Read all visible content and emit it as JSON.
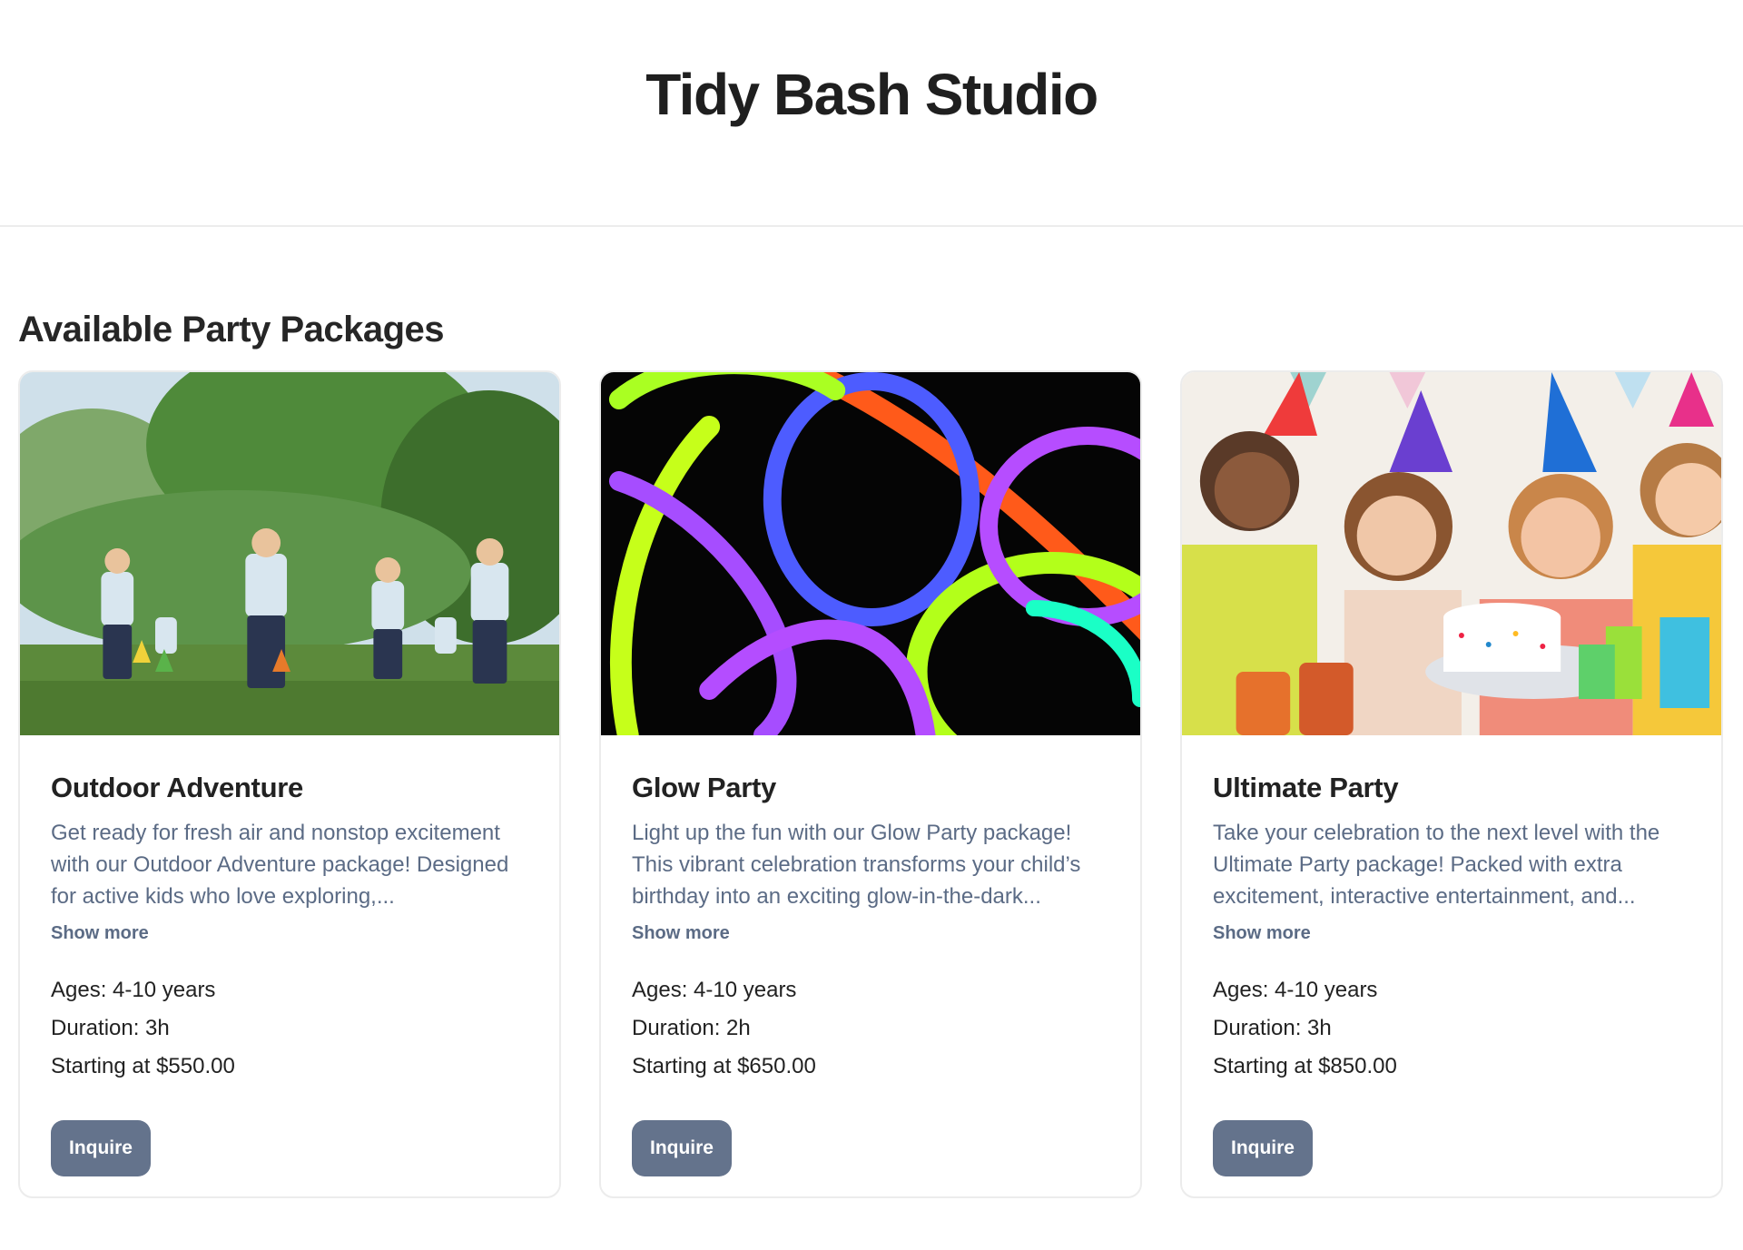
{
  "header": {
    "title": "Tidy Bash Studio"
  },
  "main": {
    "section_title": "Available Party Packages"
  },
  "colors": {
    "button_bg": "#64738c",
    "desc_text": "#5b6b85"
  },
  "packages": [
    {
      "name": "Outdoor Adventure",
      "image": "kids-playing-outdoors-photo",
      "description": "Get ready for fresh air and nonstop excitement with our Outdoor Adventure package! Designed for active kids who love exploring,...",
      "show_more": "Show more",
      "ages": "Ages: 4-10 years",
      "duration": "Duration: 3h",
      "price": "Starting at $550.00",
      "button": "Inquire"
    },
    {
      "name": "Glow Party",
      "image": "glow-sticks-photo",
      "description": "Light up the fun with our Glow Party package! This vibrant celebration transforms your child’s birthday into an exciting glow-in-the-dark...",
      "show_more": "Show more",
      "ages": "Ages: 4-10 years",
      "duration": "Duration: 2h",
      "price": "Starting at $650.00",
      "button": "Inquire"
    },
    {
      "name": "Ultimate Party",
      "image": "birthday-party-kids-photo",
      "description": "Take your celebration to the next level with the Ultimate Party package! Packed with extra excitement, interactive entertainment, and...",
      "show_more": "Show more",
      "ages": "Ages: 4-10 years",
      "duration": "Duration: 3h",
      "price": "Starting at $850.00",
      "button": "Inquire"
    }
  ]
}
